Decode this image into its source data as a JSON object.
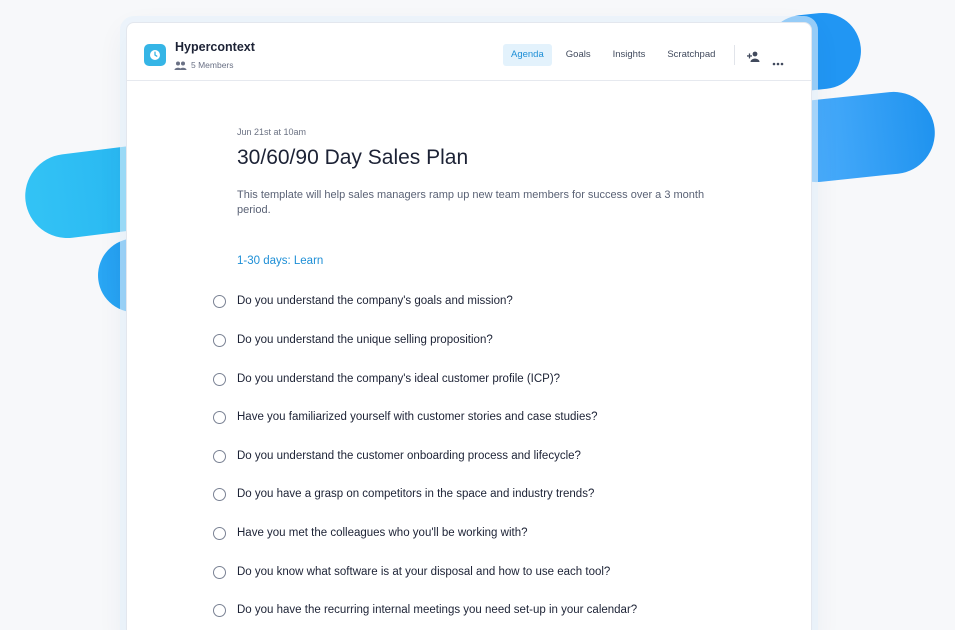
{
  "app": {
    "name": "Hypercontext",
    "members": "5 Members"
  },
  "nav": {
    "tabs": [
      "Agenda",
      "Goals",
      "Insights",
      "Scratchpad"
    ],
    "active": "Agenda"
  },
  "icons": {
    "app": "clock-icon",
    "members": "people-icon",
    "add_member": "add-person-icon",
    "more": "more-horizontal-icon"
  },
  "colors": {
    "accent": "#1e8fd6",
    "app_icon": "#35b5e6",
    "active_tab_bg": "#e3f2fc"
  },
  "meeting": {
    "date": "Jun 21st at 10am",
    "title": "30/60/90 Day Sales Plan",
    "description": "This template will help sales managers ramp up new team members for success over a 3 month period."
  },
  "section": {
    "label": "1-30 days: Learn"
  },
  "items": [
    "Do you understand the company's goals and mission?",
    "Do you understand the unique selling proposition?",
    "Do you understand the company's ideal customer profile (ICP)?",
    "Have you familiarized yourself with customer stories and case studies?",
    "Do you understand the customer onboarding process and lifecycle?",
    "Do you have a grasp on competitors in the space and industry trends?",
    "Have you met the colleagues who you'll be working with?",
    "Do you know what software is at your disposal and how to use each tool?",
    "Do you have the recurring internal meetings you need set-up in your calendar?"
  ]
}
